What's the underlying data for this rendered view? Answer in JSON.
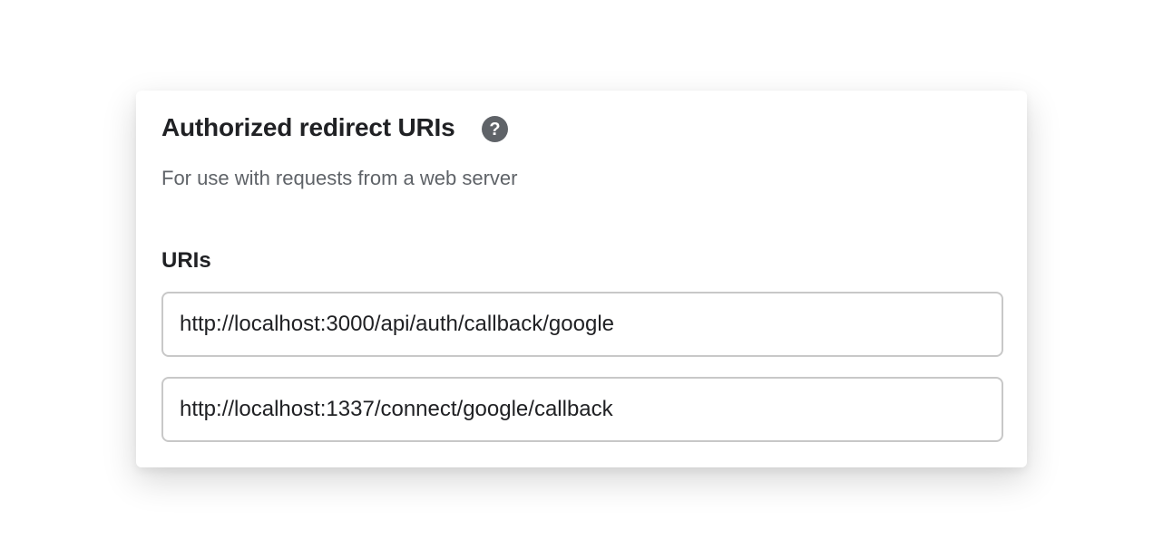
{
  "section": {
    "title": "Authorized redirect URIs",
    "help_icon": "help-circle-icon",
    "subtitle": "For use with requests from a web server"
  },
  "uris": {
    "label": "URIs",
    "items": [
      "http://localhost:3000/api/auth/callback/google",
      "http://localhost:1337/connect/google/callback"
    ]
  },
  "colors": {
    "title_text": "#202124",
    "subtitle_text": "#5f6368",
    "help_icon_bg": "#5f6368",
    "field_border": "#c8c8c8"
  }
}
